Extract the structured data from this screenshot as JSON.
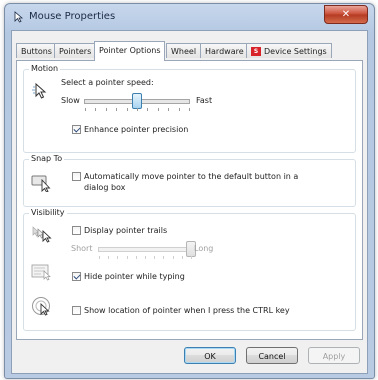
{
  "window": {
    "title": "Mouse Properties",
    "close_label": "✕"
  },
  "tabs": [
    {
      "label": "Buttons",
      "active": false
    },
    {
      "label": "Pointers",
      "active": false
    },
    {
      "label": "Pointer Options",
      "active": true
    },
    {
      "label": "Wheel",
      "active": false
    },
    {
      "label": "Hardware",
      "active": false
    },
    {
      "label": "Device Settings",
      "active": false
    }
  ],
  "motion": {
    "group_label": "Motion",
    "speed_label": "Select a pointer speed:",
    "slow_label": "Slow",
    "fast_label": "Fast",
    "speed_level": 0.5,
    "precision_label": "Enhance pointer precision",
    "precision_checked": true
  },
  "snap": {
    "group_label": "Snap To",
    "label_line1": "Automatically move pointer to the default button in a",
    "label_line2": "dialog box",
    "checked": false
  },
  "visibility": {
    "group_label": "Visibility",
    "trails_label": "Display pointer trails",
    "trails_checked": false,
    "short_label": "Short",
    "long_label": "Long",
    "trails_level": 1.0,
    "hide_label": "Hide pointer while typing",
    "hide_checked": true,
    "ctrl_label": "Show location of pointer when I press the CTRL key",
    "ctrl_checked": false
  },
  "buttons": {
    "ok": "OK",
    "cancel": "Cancel",
    "apply": "Apply"
  },
  "colors": {
    "accent": "#3c7fb1",
    "device_settings_icon": "#d8232a"
  }
}
